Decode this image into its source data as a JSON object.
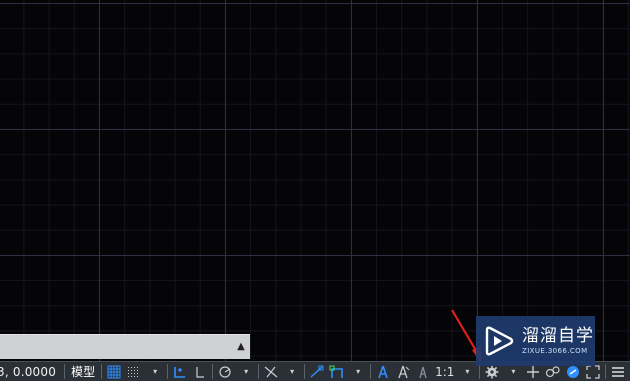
{
  "status_bar": {
    "coordinates": "3, 0.0000",
    "model_tab": "模型",
    "annotation_scale": "1:1",
    "dropdown_glyph": "▾"
  },
  "command_line": {
    "collapse_glyph": "▲"
  },
  "watermark": {
    "title": "溜溜自学",
    "url": "ZIXUE.3066.COM"
  },
  "colors": {
    "background": "#050508",
    "major_grid": "#2c3040",
    "minor_grid": "#13151d",
    "status_bar": "#2b3036",
    "accent_blue": "#2e8fff",
    "arrow": "#e0201e",
    "watermark_bg": "#1e3c6e"
  },
  "icons": [
    "grid-icon",
    "snap-icon",
    "infer-constraints-icon",
    "ortho-icon",
    "polar-icon",
    "osnap-icon",
    "osnap-track-icon",
    "dynamic-ucs-icon",
    "annotation-visibility-icon",
    "auto-scale-icon",
    "annotation-scale-icon",
    "workspace-gear-icon",
    "plus-icon",
    "isolate-icon",
    "hardware-accel-icon",
    "fullscreen-icon",
    "customize-icon"
  ]
}
